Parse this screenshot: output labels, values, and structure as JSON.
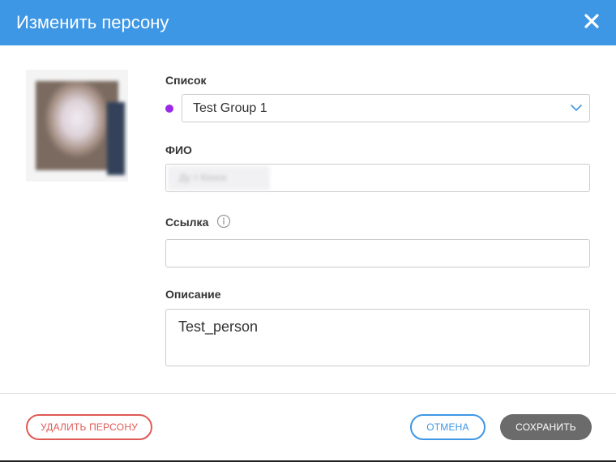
{
  "dialog": {
    "title": "Изменить персону",
    "close_icon": "close-icon"
  },
  "photo": {
    "icon": "person-photo"
  },
  "fields": {
    "list": {
      "label": "Список",
      "value": "Test Group 1",
      "dot_color": "#9b2ae8"
    },
    "fio": {
      "label": "ФИО",
      "value": "Ду т Кенск"
    },
    "link": {
      "label": "Ссылка",
      "value": "",
      "info_icon": "info-icon"
    },
    "description": {
      "label": "Описание",
      "value": "Test_person"
    }
  },
  "footer": {
    "delete_label": "УДАЛИТЬ ПЕРСОНУ",
    "cancel_label": "ОТМЕНА",
    "save_label": "СОХРАНИТЬ"
  },
  "colors": {
    "header": "#3d97e5",
    "danger": "#e05a55",
    "accent": "#3d97e5",
    "save": "#6b6b6b"
  }
}
